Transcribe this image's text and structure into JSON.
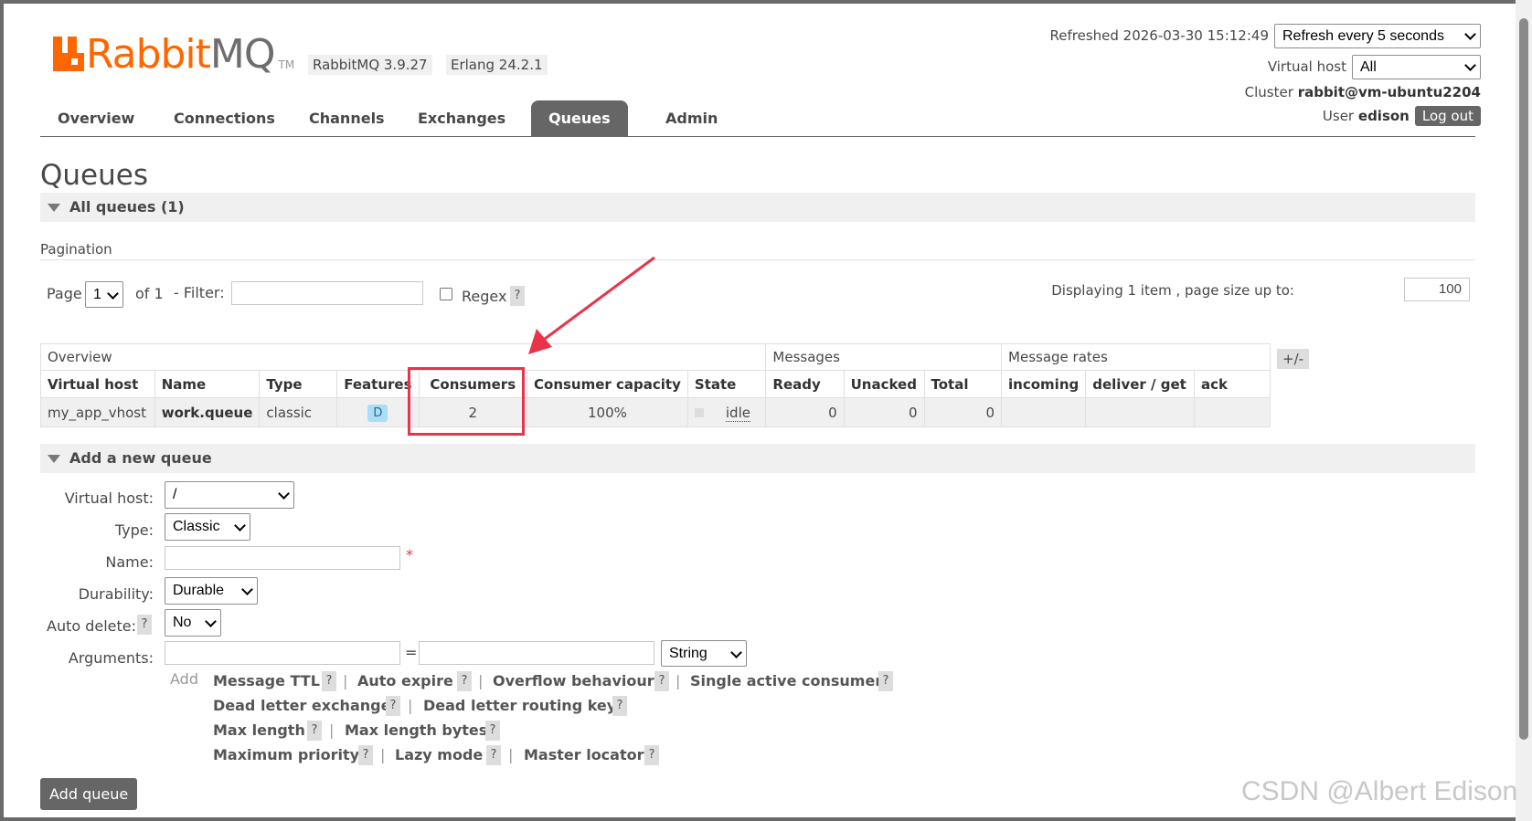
{
  "header": {
    "logo_rabbit": "Rabbit",
    "logo_mq": "MQ",
    "logo_tm": "TM",
    "rabbitmq_version": "RabbitMQ 3.9.27",
    "erlang_version": "Erlang 24.2.1",
    "refreshed_label": "Refreshed 2026-03-30 15:12:49",
    "refresh_select": "Refresh every 5 seconds",
    "vhost_label": "Virtual host",
    "vhost_select": "All",
    "cluster_label": "Cluster",
    "cluster_name": "rabbit@vm-ubuntu2204",
    "user_label": "User",
    "user_name": "edison",
    "logout_label": "Log out"
  },
  "tabs": [
    {
      "label": "Overview"
    },
    {
      "label": "Connections"
    },
    {
      "label": "Channels"
    },
    {
      "label": "Exchanges"
    },
    {
      "label": "Queues",
      "active": true
    },
    {
      "label": "Admin"
    }
  ],
  "page_title": "Queues",
  "all_queues": {
    "title": "All queues (1)",
    "pagination_label": "Pagination",
    "page_label": "Page",
    "page_value": "1",
    "of_label": "of 1",
    "filter_label": "- Filter:",
    "filter_value": "",
    "regex_label": "Regex",
    "help": "?",
    "displaying": "Displaying 1 item , page size up to:",
    "page_size": "100",
    "plus_minus": "+/-"
  },
  "table": {
    "groups": [
      "Overview",
      "Messages",
      "Message rates"
    ],
    "columns": [
      "Virtual host",
      "Name",
      "Type",
      "Features",
      "Consumers",
      "Consumer capacity",
      "State",
      "Ready",
      "Unacked",
      "Total",
      "incoming",
      "deliver / get",
      "ack"
    ],
    "rows": [
      {
        "vhost": "my_app_vhost",
        "name": "work.queue",
        "type": "classic",
        "features": "D",
        "consumers": "2",
        "capacity": "100%",
        "state": "idle",
        "ready": "0",
        "unacked": "0",
        "total": "0",
        "incoming": "",
        "deliver_get": "",
        "ack": ""
      }
    ]
  },
  "add_queue": {
    "title": "Add a new queue",
    "vhost_label": "Virtual host:",
    "vhost_value": "/",
    "type_label": "Type:",
    "type_value": "Classic",
    "name_label": "Name:",
    "name_value": "",
    "required_mark": "*",
    "durability_label": "Durability:",
    "durability_value": "Durable",
    "autodelete_label": "Auto delete:",
    "autodelete_value": "No",
    "arguments_label": "Arguments:",
    "arg_equals": "=",
    "arg_type": "String",
    "add_label": "Add",
    "arg_links": [
      "Message TTL",
      "Auto expire",
      "Overflow behaviour",
      "Single active consumer",
      "Dead letter exchange",
      "Dead letter routing key",
      "Max length",
      "Max length bytes",
      "Maximum priority",
      "Lazy mode",
      "Master locator"
    ],
    "separator": "|",
    "submit_label": "Add queue"
  },
  "watermark": "CSDN @Albert Edison"
}
